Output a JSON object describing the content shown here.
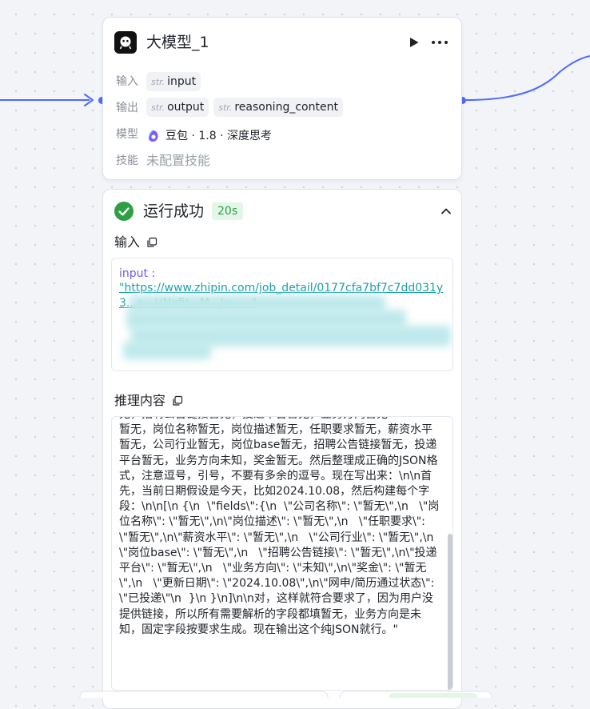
{
  "node": {
    "title": "大模型_1",
    "labels": {
      "input": "输入",
      "output": "输出",
      "model": "模型",
      "skills": "技能"
    },
    "input_params": [
      {
        "type": "str.",
        "name": "input"
      }
    ],
    "output_params": [
      {
        "type": "str.",
        "name": "output"
      },
      {
        "type": "str.",
        "name": "reasoning_content"
      }
    ],
    "model": {
      "icon": "doubao-logo-icon",
      "name": "豆包 · 1.8 · 深度思考"
    },
    "skills_value": "未配置技能"
  },
  "result": {
    "status": "运行成功",
    "duration": "20s",
    "input_title": "输入",
    "input_key": "input :",
    "input_value": "\"https://www.zhipin.com/job_detail/0177cfa7bf7c7dd031y3...e...HNxfit...M...Jw~~\"",
    "reasoning_title": "推理内容",
    "reasoning_text": "无，招聘公告链接暂无，投递平台暂无，业务方向暂无\n暂无，岗位名称暂无，岗位描述暂无，任职要求暂无，薪资水平暂无，公司行业暂无，岗位base暂无，招聘公告链接暂无，投递平台暂无，业务方向未知，奖金暂无。然后整理成正确的JSON格式，注意逗号，引号，不要有多余的逗号。现在写出来：\\n\\n首先，当前日期假设是今天，比如2024.10.08，然后构建每个字段：\\n\\n[\\n {\\n  \\\"fields\\\":{\\n  \\\"公司名称\\\": \\\"暂无\\\",\\n   \\\"岗位名称\\\": \\\"暂无\\\",\\n\\\"岗位描述\\\": \\\"暂无\\\",\\n   \\\"任职要求\\\": \\\"暂无\\\",\\n\\\"薪资水平\\\": \\\"暂无\\\",\\n   \\\"公司行业\\\": \\\"暂无\\\",\\n\\\"岗位base\\\": \\\"暂无\\\",\\n   \\\"招聘公告链接\\\": \\\"暂无\\\",\\n\\\"投递平台\\\": \\\"暂无\\\",\\n   \\\"业务方向\\\": \\\"未知\\\",\\n\\\"奖金\\\": \\\"暂无\\\",\\n   \\\"更新日期\\\": \\\"2024.10.08\\\",\\n\\\"网申/简历通过状态\\\": \\\"已投递\\\"\\n  }\\n }\\n]\\n\\n对，这样就符合要求了，因为用户没提供链接，所以所有需要解析的字段都填暂无，业务方向是未知，固定字段按要求生成。现在输出这个纯JSON就行。\""
  },
  "colors": {
    "accent": "#4d6bfe",
    "success": "#2ea043",
    "link": "#1a9ea7",
    "key": "#6b5cf0"
  }
}
